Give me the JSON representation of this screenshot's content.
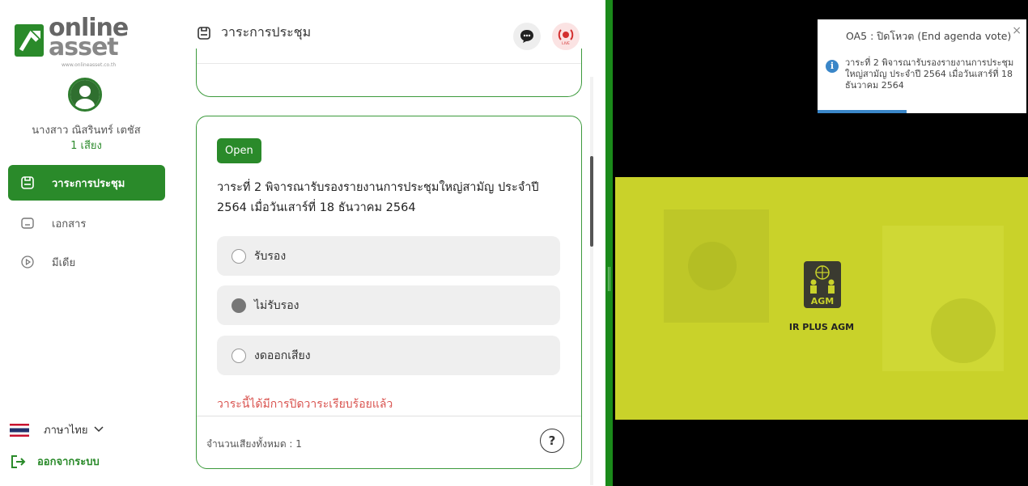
{
  "brand": {
    "line1": "online",
    "line2": "asset",
    "url": "www.onlineasset.co.th"
  },
  "user": {
    "name": "นางสาว ณิสรินทร์ เตชัส",
    "votes": "1 เสียง"
  },
  "sidebar": {
    "items": [
      {
        "label": "วาระการประชุม",
        "icon": "agenda-icon",
        "active": true
      },
      {
        "label": "เอกสาร",
        "icon": "folder-icon",
        "active": false
      },
      {
        "label": "มีเดีย",
        "icon": "play-icon",
        "active": false
      }
    ],
    "language": "ภาษาไทย",
    "logout": "ออกจากระบบ"
  },
  "header": {
    "title": "วาระการประชุม"
  },
  "agenda": {
    "status": "Open",
    "question": "วาระที่ 2 พิจารณารับรองรายงานการประชุมใหญ่สามัญ ประจำปี 2564 เมื่อวันเสาร์ที่ 18 ธันวาคม 2564",
    "options": [
      {
        "label": "รับรอง",
        "selected": false
      },
      {
        "label": "ไม่รับรอง",
        "selected": true
      },
      {
        "label": "งดออกเสียง",
        "selected": false
      }
    ],
    "closed_message": "วาระนี้ได้มีการปิดวาระเรียบร้อยแล้ว",
    "total_votes": "จำนวนเสียงทั้งหมด : 1"
  },
  "video": {
    "logo_label": "IR PLUS AGM",
    "logo_badge": "AGM"
  },
  "toast": {
    "title": "OA5 : ปิดโหวต (End agenda vote)",
    "body": "วาระที่ 2 พิจารณารับรองรายงานการประชุมใหญ่สามัญ ประจำปี 2564 เมื่อวันเสาร์ที่ 18 ธันวาคม 2564"
  },
  "colors": {
    "primary": "#2a8a2a",
    "danger": "#d9534f",
    "info": "#3a86c8",
    "video_bg": "#c9d22a"
  }
}
